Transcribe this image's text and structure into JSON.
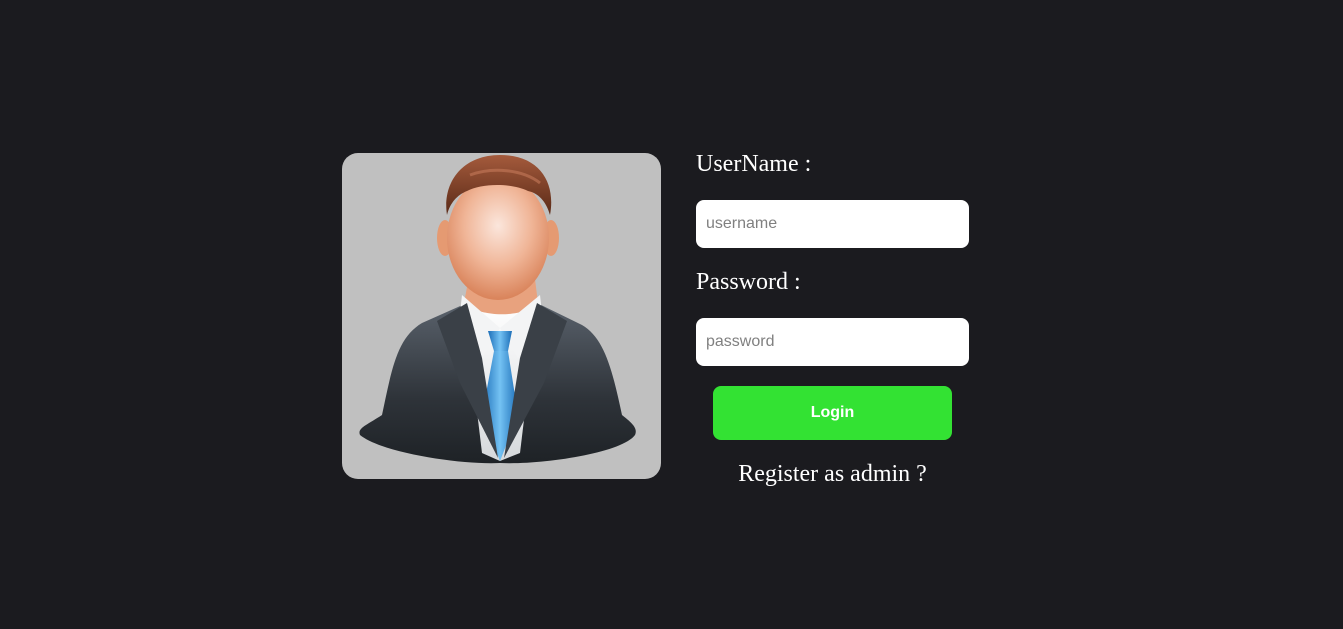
{
  "avatar": {
    "icon": "businessman-avatar-icon",
    "background_color": "#c0c0c0"
  },
  "form": {
    "username_label": "UserName :",
    "username_placeholder": "username",
    "username_value": "",
    "password_label": "Password :",
    "password_placeholder": "password",
    "password_value": "",
    "login_label": "Login",
    "register_link": "Register as admin ?"
  },
  "colors": {
    "page_background": "#1b1b1f",
    "login_button": "#33e233",
    "text": "#ffffff"
  }
}
